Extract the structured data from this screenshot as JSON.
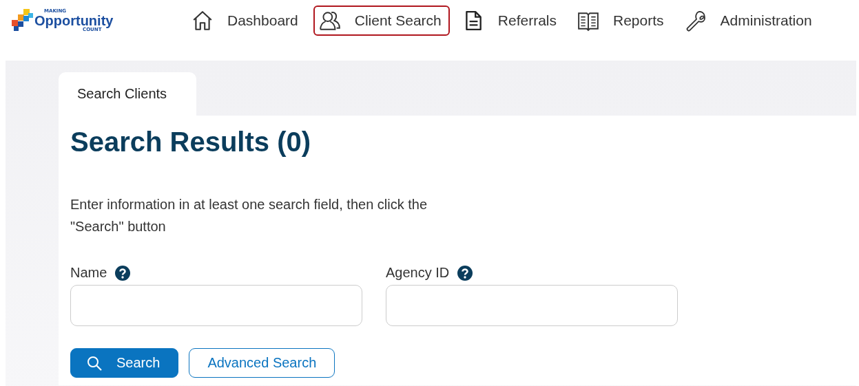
{
  "logo": {
    "top": "MAKING",
    "main": "Opportunity",
    "bottom": "COUNT"
  },
  "nav": [
    {
      "kind": "home",
      "label": "Dashboard",
      "selected": false
    },
    {
      "kind": "people",
      "label": "Client Search",
      "selected": true
    },
    {
      "kind": "document",
      "label": "Referrals",
      "selected": false
    },
    {
      "kind": "book",
      "label": "Reports",
      "selected": false
    },
    {
      "kind": "wrench",
      "label": "Administration",
      "selected": false
    }
  ],
  "tabs": [
    {
      "label": "Search Clients",
      "selected": true
    }
  ],
  "heading": "Search Results (0)",
  "instructions": "Enter information in at least one search field, then click the \"Search\" button",
  "fields": [
    {
      "label": "Name"
    },
    {
      "label": "Agency ID"
    }
  ],
  "buttons": [
    {
      "kind": "primary",
      "label": "Search"
    },
    {
      "kind": "outline",
      "label": "Advanced Search"
    }
  ]
}
